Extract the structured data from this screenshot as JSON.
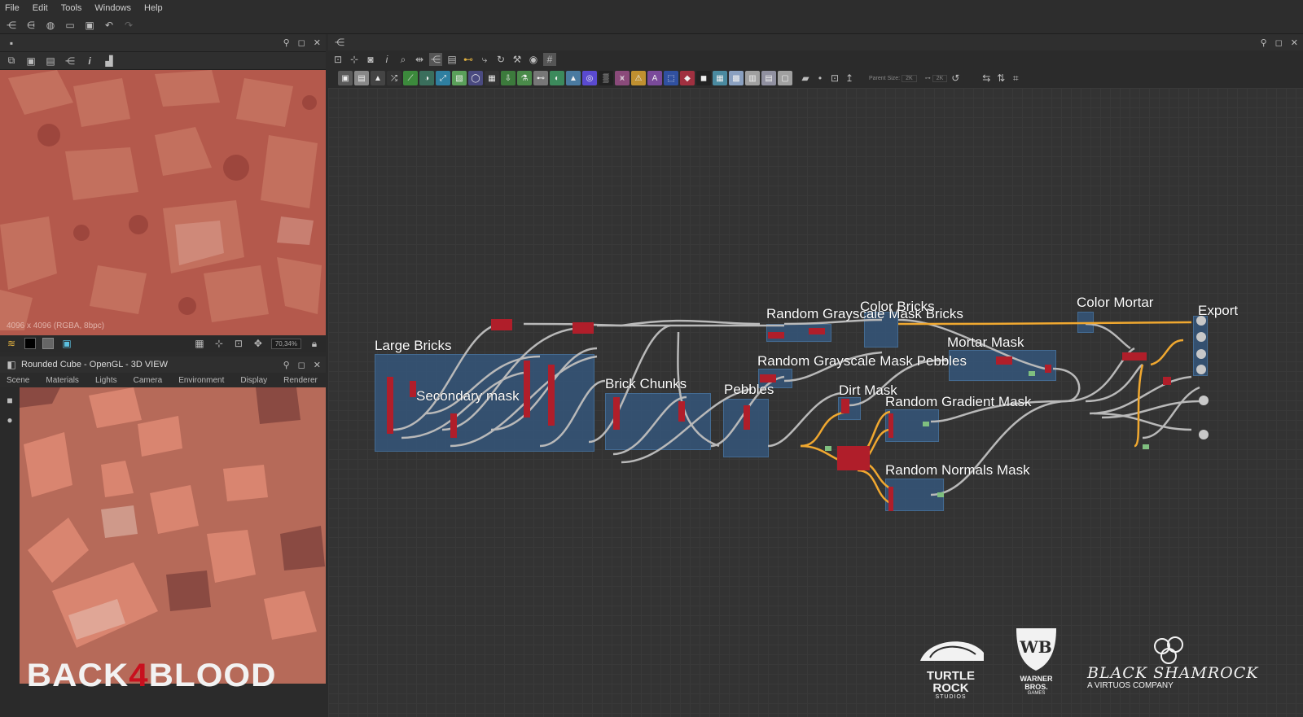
{
  "menu": [
    "File",
    "Edit",
    "Tools",
    "Windows",
    "Help"
  ],
  "view2d": {
    "info": "4096 x 4096 (RGBA, 8bpc)",
    "zoom": "70,34%"
  },
  "view3d": {
    "title": "Rounded Cube - OpenGL - 3D VIEW",
    "tabs": [
      "Scene",
      "Materials",
      "Lights",
      "Camera",
      "Environment",
      "Display",
      "Renderer"
    ]
  },
  "graph": {
    "parent_size_label": "Parent Size:",
    "parent_size_value": "2K",
    "size_value": "2K",
    "frames": [
      {
        "label": "Large Bricks"
      },
      {
        "label": "Secondary mask"
      },
      {
        "label": "Brick Chunks"
      },
      {
        "label": "Pebbles"
      },
      {
        "label": "Random Grayscale Mask Bricks"
      },
      {
        "label": "Color Bricks"
      },
      {
        "label": "Random Grayscale Mask Pebbles"
      },
      {
        "label": "Dirt Mask"
      },
      {
        "label": "Random Gradient Mask"
      },
      {
        "label": "Random Normals Mask"
      },
      {
        "label": "Mortar Mask"
      },
      {
        "label": "Color Mortar"
      },
      {
        "label": "Export"
      }
    ]
  },
  "logos": {
    "b4b_a": "BACK",
    "b4b_num": "4",
    "b4b_b": "BLOOD",
    "turtle_rock": "TURTLE ROCK",
    "turtle_rock_sub": "STUDIOS",
    "wb": "WARNER BROS.",
    "wb_sub": "GAMES",
    "black_shamrock": "BLACK SHAMROCK",
    "black_shamrock_sub": "A VIRTUOS COMPANY"
  },
  "colors": {
    "frame_blue": "#345880",
    "node_red": "#b01e2a",
    "wire_grey": "#b9b9b9",
    "wire_orange": "#f0a830"
  }
}
